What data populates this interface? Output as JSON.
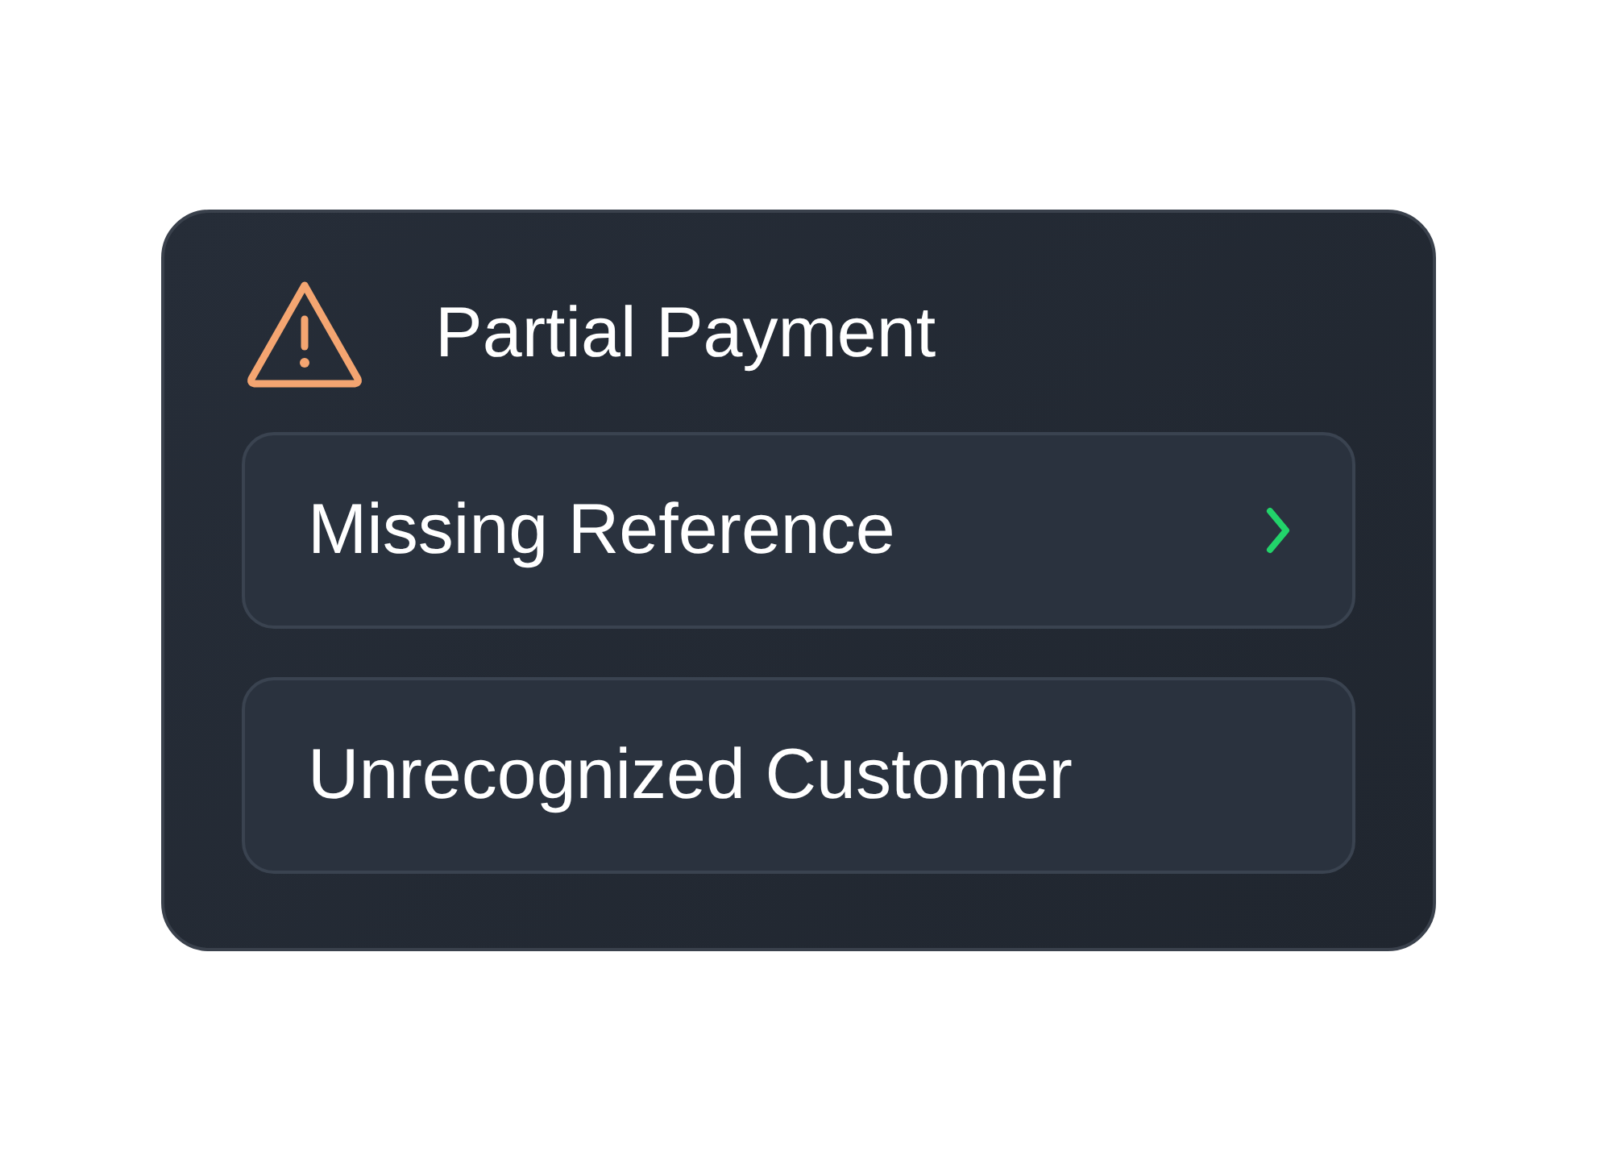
{
  "card": {
    "title": "Partial Payment",
    "items": [
      {
        "label": "Missing Reference",
        "chevron": true
      },
      {
        "label": "Unrecognized Customer",
        "chevron": false
      }
    ]
  }
}
